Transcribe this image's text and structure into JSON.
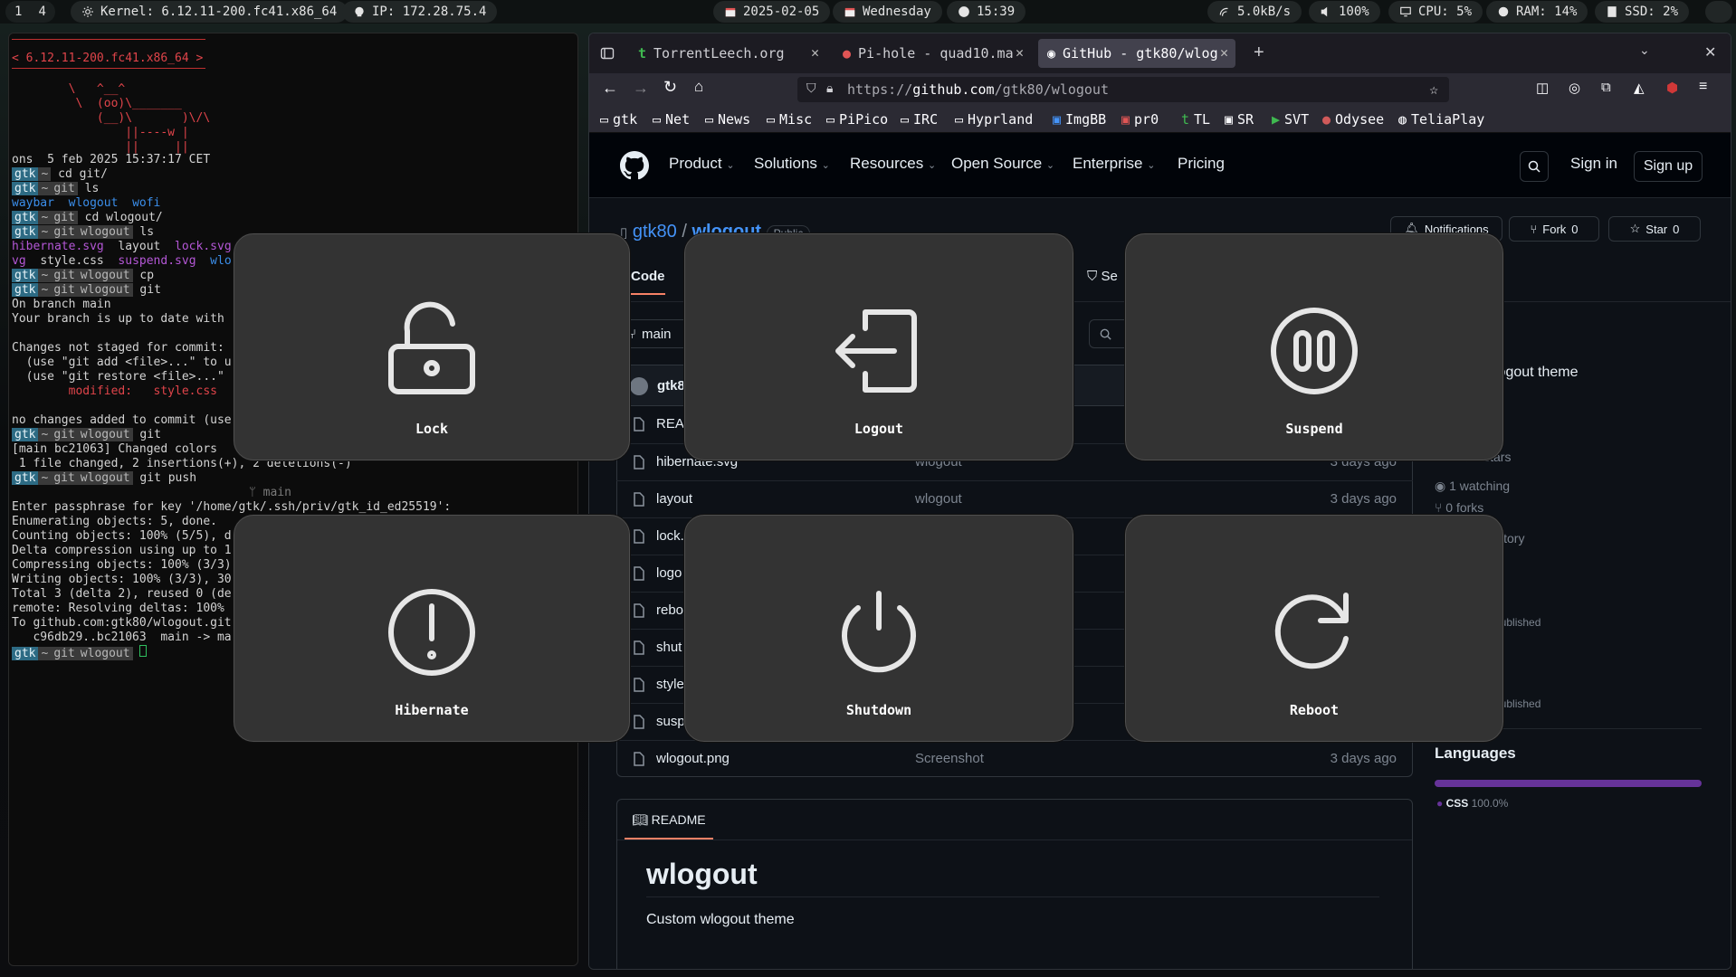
{
  "topbar": {
    "workspaces": [
      "1",
      "4"
    ],
    "kernel": "Kernel: 6.12.11-200.fc41.x86_64",
    "ip": "IP: 172.28.75.4",
    "date": "2025-02-05",
    "weekday": "Wednesday",
    "time": "15:39",
    "net": "5.0kB/s",
    "volume": "100%",
    "cpu": "CPU:  5%",
    "ram": "RAM: 14%",
    "ssd": "SSD:  2%"
  },
  "terminal": {
    "kernel_banner": "< 6.12.11-200.fc41.x86_64 >",
    "cow": [
      "        \\   ^__^",
      "         \\  (oo)\\_______",
      "            (__)\\       )\\/\\",
      "                ||----w |",
      "                ||     ||"
    ],
    "lines": {
      "l1": "ons  5 feb 2025 15:37:17 CET",
      "cmd1": "cd git/",
      "cmd2": "ls",
      "ls1a": "waybar",
      "ls1b": "wlogout",
      "ls1c": "wofi",
      "cmd3": "cd wlogout/",
      "cmd4": "ls",
      "ls2a": "hibernate.svg",
      "ls2b": "layout",
      "ls2c": "lock.svg",
      "ls3a": "vg",
      "ls3b": "style.css",
      "ls3c": "suspend.svg",
      "ls3d": "wlo",
      "cmd5": "cp",
      "cmd6": "git",
      "st1": "On branch main",
      "st2": "Your branch is up to date with",
      "st3": "Changes not staged for commit:",
      "st4": "  (use \"git add <file>...\" to u",
      "st5": "  (use \"git restore <file>...\"",
      "st6": "        modified:   style.css",
      "st7": "no changes added to commit (use",
      "cmd7": "git",
      "c1": "[main bc21063] Changed colors",
      "c2": " 1 file changed, 2 insertions(+), 2 deletions(-)",
      "cmd8": "git push",
      "branch": "ᛘ main",
      "p1": "Enter passphrase for key '/home/gtk/.ssh/priv/gtk_id_ed25519':",
      "p2": "Enumerating objects: 5, done.",
      "p3": "Counting objects: 100% (5/5), d",
      "p4": "Delta compression using up to 1",
      "p5": "Compressing objects: 100% (3/3)",
      "p6": "Writing objects: 100% (3/3), 30",
      "p7": "Total 3 (delta 2), reused 0 (de",
      "p8": "remote: Resolving deltas: 100%",
      "p9": "To github.com:gtk80/wlogout.git",
      "p10": "   c96db29..bc21063  main -> ma"
    },
    "prompt_user": "gtk",
    "prompt_home": "~",
    "prompt_git": "git",
    "prompt_wlogout": "wlogout"
  },
  "browser": {
    "tabs": [
      {
        "label": "TorrentLeech.org"
      },
      {
        "label": "Pi-hole - quad10.ma"
      },
      {
        "label": "GitHub - gtk80/wlog"
      }
    ],
    "url_prefix": "https://",
    "url_host": "github.com",
    "url_path": "/gtk80/wlogout",
    "bookmarks": [
      "gtk",
      "Net",
      "News",
      "Misc",
      "PiPico",
      "IRC",
      "Hyprland",
      "ImgBB",
      "pr0",
      "TL",
      "SR",
      "SVT",
      "Odysee",
      "TeliaPlay"
    ]
  },
  "github": {
    "nav": [
      "Product",
      "Solutions",
      "Resources",
      "Open Source",
      "Enterprise",
      "Pricing"
    ],
    "sign_in": "Sign in",
    "sign_up": "Sign up",
    "owner": "gtk80",
    "repo": "wlogout",
    "visibility": "Public",
    "notifications": "Notifications",
    "fork": "Fork",
    "fork_count": "0",
    "star": "Star",
    "star_count": "0",
    "code_tab": "Code",
    "sec_tab": "Se",
    "branch": "main",
    "commit_author": "gtk8",
    "files": [
      {
        "name": "READ",
        "msg": "",
        "date": ""
      },
      {
        "name": "hibernate.svg",
        "msg": "wlogout",
        "date": "3 days ago"
      },
      {
        "name": "layout",
        "msg": "wlogout",
        "date": "3 days ago"
      },
      {
        "name": "lock.",
        "msg": "",
        "date": ""
      },
      {
        "name": "logo",
        "msg": "",
        "date": ""
      },
      {
        "name": "rebo",
        "msg": "",
        "date": ""
      },
      {
        "name": "shut",
        "msg": "",
        "date": ""
      },
      {
        "name": "style",
        "msg": "",
        "date": ""
      },
      {
        "name": "suspe",
        "msg": "",
        "date": ""
      },
      {
        "name": "wlogout.png",
        "msg": "Screenshot",
        "date": "3 days ago"
      }
    ],
    "about_desc": "logout theme",
    "stars_text": "0 stars",
    "watching": "1 watching",
    "forks_text": "0 forks",
    "repo_report": "sitory",
    "published1": "published",
    "published2": "published",
    "languages_title": "Languages",
    "language": "CSS",
    "language_pct": "100.0%",
    "language_fraction": 1.0,
    "readme_tab": "README",
    "readme_title": "wlogout",
    "readme_desc": "Custom wlogout theme"
  },
  "wlogout": {
    "buttons": [
      {
        "label": "Lock",
        "icon": "lock-icon"
      },
      {
        "label": "Logout",
        "icon": "logout-icon"
      },
      {
        "label": "Suspend",
        "icon": "suspend-icon"
      },
      {
        "label": "Hibernate",
        "icon": "hibernate-icon"
      },
      {
        "label": "Shutdown",
        "icon": "shutdown-icon"
      },
      {
        "label": "Reboot",
        "icon": "reboot-icon"
      }
    ]
  },
  "colors": {
    "accent_github_link": "#4493f8",
    "language_bar": "#663399",
    "terminal_prompt_bg": "#2d6b84"
  }
}
